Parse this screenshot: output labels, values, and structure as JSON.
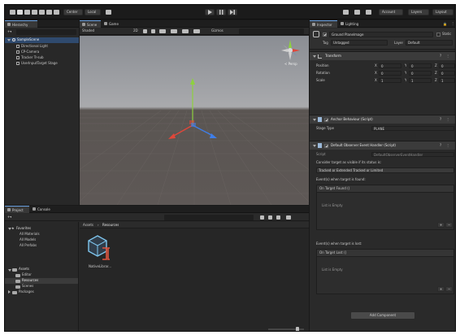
{
  "toolbar": {
    "account_label": "Account",
    "layers_label": "Layers",
    "layout_label": "Layout",
    "local_label": "Local",
    "center_label": "Center"
  },
  "hierarchy": {
    "tab": "Hierarchy",
    "scene": "SampleScene",
    "items": [
      "Directional Light",
      "CP-Camera",
      "Tracker Tr-sub",
      "UserInputTarget Stage"
    ]
  },
  "scene_view": {
    "tab_scene": "Scene",
    "tab_game": "Game",
    "shading_mode": "Shaded",
    "mode_2d": "2D",
    "gizmos_label": "Gizmos",
    "persp_label": "< Persp"
  },
  "project": {
    "tab_project": "Project",
    "tab_console": "Console",
    "favorites_label": "Favorites",
    "favorites": [
      "All Materials",
      "All Models",
      "All Prefabs"
    ],
    "assets_label": "Assets",
    "assets_children": [
      "Editor",
      "Resources",
      "Scenes"
    ],
    "packages_label": "Packages",
    "breadcrumb_root": "Assets",
    "breadcrumb_current": "Resources",
    "asset_name": "NativeLibrar..."
  },
  "inspector": {
    "tab_inspector": "Inspector",
    "tab_lighting": "Lighting",
    "object_name": "Ground Planelmage",
    "static_label": "Static",
    "tag_label": "Tag",
    "tag_value": "Untagged",
    "layer_label": "Layer",
    "layer_value": "Default",
    "transform": {
      "title": "Transform",
      "rows": [
        {
          "label": "Position",
          "x": "0",
          "y": "0",
          "z": "0"
        },
        {
          "label": "Rotation",
          "x": "0",
          "y": "0",
          "z": "0"
        },
        {
          "label": "Scale",
          "x": "1",
          "y": "1",
          "z": "1"
        }
      ],
      "axes": [
        "X",
        "Y",
        "Z"
      ]
    },
    "anchor_behaviour": {
      "title": "Anchor Behaviour (Script)",
      "stage_type_label": "Stage Type",
      "stage_type_value": "PLANE"
    },
    "default_observer": {
      "title": "Default Observer Event Handler (Script)",
      "script_label": "Script",
      "script_value": "DefaultObserverEventHandler",
      "consider_label": "Consider target as visible if its status is:",
      "consider_value": "Tracked or Extended Tracked or Limited",
      "on_found_label": "Event(s) when target is found:",
      "on_found_box_label": "On Target Found ()",
      "on_lost_label": "Event(s) when target is lost:",
      "on_lost_box_label": "On Target Lost ()",
      "list_empty": "List is Empty"
    },
    "add_component": "Add Component"
  },
  "colors": {
    "background": "#191919",
    "panel": "#282828",
    "accent": "#6aa0e0",
    "axis_x": "#e0473a",
    "axis_y": "#8ed13f",
    "axis_z": "#3f7ee8"
  }
}
